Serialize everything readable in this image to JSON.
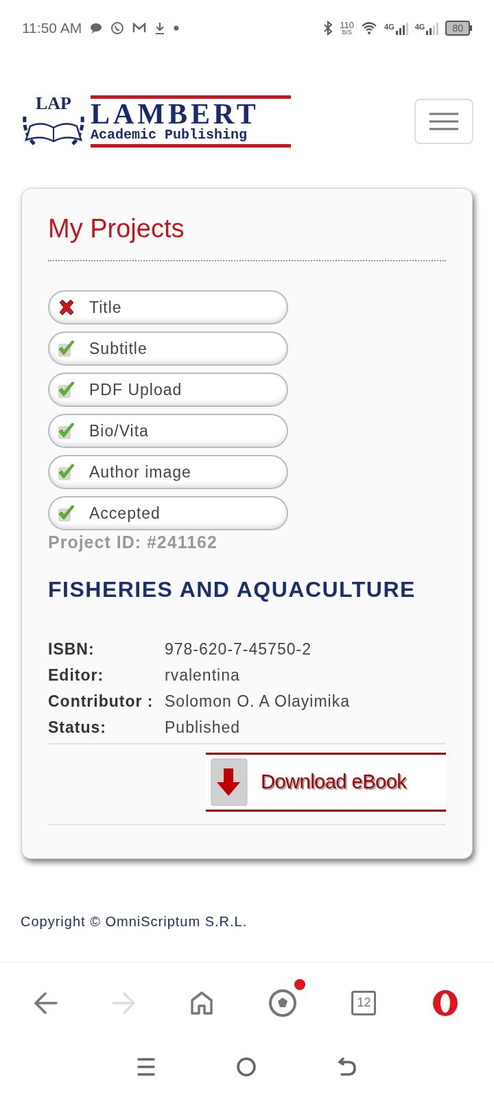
{
  "status_bar": {
    "time": "11:50 AM",
    "net_speed": "110",
    "net_unit": "B/S",
    "sim1": "4G",
    "sim2": "4G",
    "battery": "80"
  },
  "logo": {
    "badge": "LAP",
    "name": "LAMBERT",
    "subtitle": "Academic Publishing"
  },
  "card": {
    "title": "My Projects",
    "checklist": [
      {
        "label": "Title",
        "checked": false
      },
      {
        "label": "Subtitle",
        "checked": true
      },
      {
        "label": "PDF Upload",
        "checked": true
      },
      {
        "label": "Bio/Vita",
        "checked": true
      },
      {
        "label": "Author image",
        "checked": true
      },
      {
        "label": "Accepted",
        "checked": true
      }
    ],
    "project_id": "Project ID: #241162",
    "book_title": "FISHERIES AND AQUACULTURE",
    "details": [
      {
        "label": "ISBN:",
        "value": "978-620-7-45750-2"
      },
      {
        "label": "Editor:",
        "value": "rvalentina"
      },
      {
        "label": "Contributor :",
        "value": "Solomon O. A Olayimika"
      },
      {
        "label": "Status:",
        "value": "Published"
      }
    ],
    "download_button": "Download eBook"
  },
  "footer": "Copyright © OmniScriptum S.R.L.",
  "browser_bar": {
    "tab_count": "12"
  }
}
